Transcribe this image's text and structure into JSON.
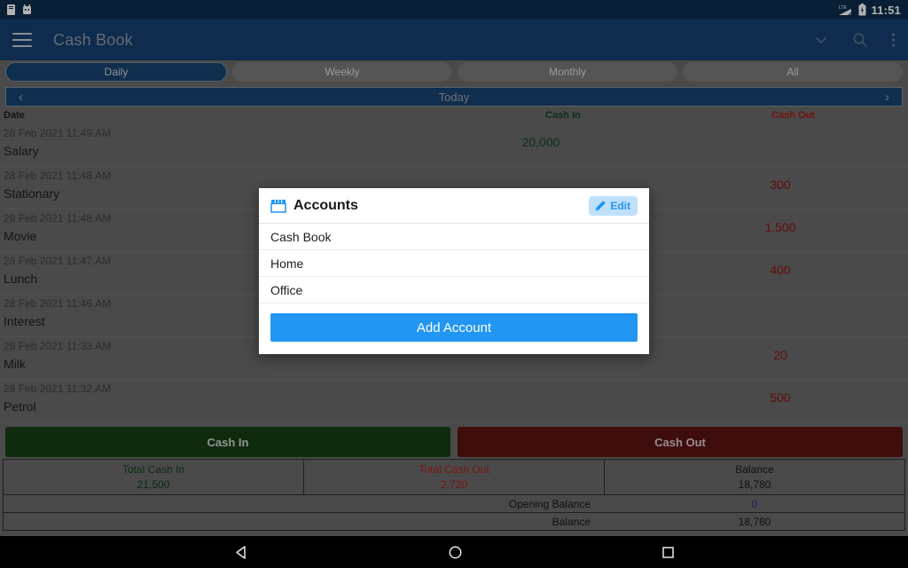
{
  "statusbar": {
    "icons": [
      "note-notification-icon",
      "robot-notification-icon"
    ],
    "network": "lte-signal-icon",
    "network_label": "LTE",
    "battery": "battery-icon",
    "time": "11:51"
  },
  "appbar": {
    "menu_icon": "hamburger-menu-icon",
    "title": "Cash Book",
    "actions": [
      {
        "name": "chevron-down-icon",
        "label": "⌄"
      },
      {
        "name": "search-icon",
        "label": ""
      },
      {
        "name": "overflow-menu-icon",
        "label": ""
      }
    ]
  },
  "tabs": [
    {
      "label": "Daily",
      "active": true
    },
    {
      "label": "Weekly",
      "active": false
    },
    {
      "label": "Monthly",
      "active": false
    },
    {
      "label": "All",
      "active": false
    }
  ],
  "period_nav": {
    "prev": "‹",
    "label": "Today",
    "next": "›"
  },
  "table": {
    "headers": {
      "date": "Date",
      "cash_in": "Cash In",
      "cash_out": "Cash Out"
    },
    "rows": [
      {
        "date": "28 Feb 2021 11:49.AM",
        "desc": "Salary",
        "cash_in": "20,000",
        "cash_out": ""
      },
      {
        "date": "28 Feb 2021 11:48.AM",
        "desc": "Stationary",
        "cash_in": "",
        "cash_out": "300"
      },
      {
        "date": "28 Feb 2021 11:48.AM",
        "desc": "Movie",
        "cash_in": "",
        "cash_out": "1,500"
      },
      {
        "date": "28 Feb 2021 11:47.AM",
        "desc": "Lunch",
        "cash_in": "",
        "cash_out": "400"
      },
      {
        "date": "28 Feb 2021 11:46.AM",
        "desc": "Interest",
        "cash_in": "",
        "cash_out": ""
      },
      {
        "date": "28 Feb 2021 11:33.AM",
        "desc": "Milk",
        "cash_in": "",
        "cash_out": "20"
      },
      {
        "date": "28 Feb 2021 11:32.AM",
        "desc": "Petrol",
        "cash_in": "",
        "cash_out": "500"
      }
    ]
  },
  "actions": {
    "cash_in": "Cash In",
    "cash_out": "Cash Out"
  },
  "summary": {
    "total_cash_in_label": "Total Cash In",
    "total_cash_in_value": "21,500",
    "total_cash_out_label": "Total Cash Out",
    "total_cash_out_value": "2,720",
    "balance_label": "Balance",
    "balance_value": "18,780",
    "opening_balance_label": "Opening Balance",
    "opening_balance_value": "0",
    "final_balance_label": "Balance",
    "final_balance_value": "18,780"
  },
  "dialog": {
    "icon": "storefront-icon",
    "title": "Accounts",
    "edit_label": "Edit",
    "edit_icon": "pencil-icon",
    "items": [
      {
        "label": "Cash Book"
      },
      {
        "label": "Home"
      },
      {
        "label": "Office"
      }
    ],
    "add_label": "Add Account"
  },
  "navbar": {
    "back": "back-triangle-icon",
    "home": "home-circle-icon",
    "recents": "recents-square-icon"
  },
  "colors": {
    "appbar": "#164070",
    "statusbar": "#0e2d4d",
    "accent_blue": "#2196f3",
    "cash_in_green": "#173d14",
    "cash_out_red": "#5a1312",
    "background": "#6b6b6b"
  }
}
